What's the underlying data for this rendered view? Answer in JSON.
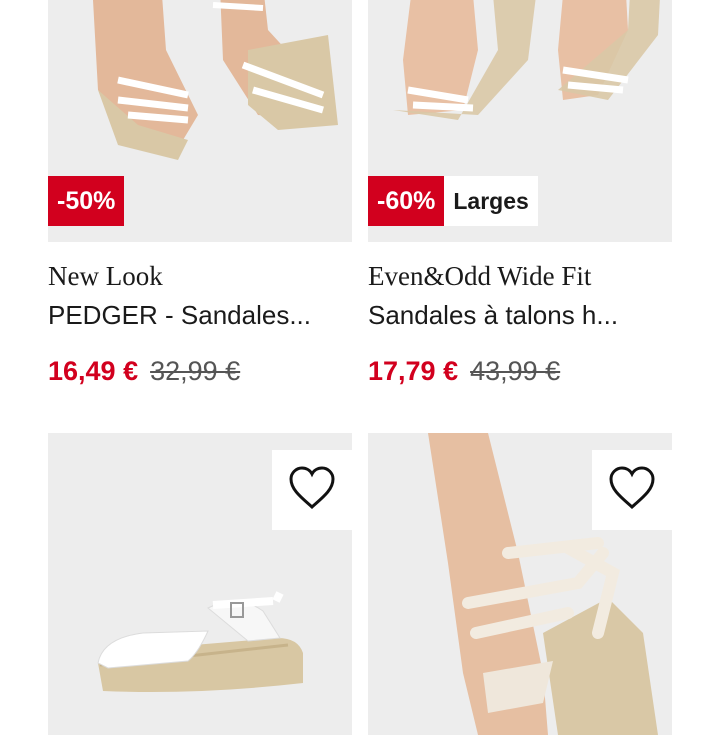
{
  "colors": {
    "sale_red": "#d2001e"
  },
  "products": [
    {
      "brand": "New Look",
      "name": "PEDGER - Sandales...",
      "price": "16,49 €",
      "original_price": "32,99 €",
      "badges": [
        {
          "text": "-50%",
          "kind": "discount"
        }
      ]
    },
    {
      "brand": "Even&Odd Wide Fit",
      "name": "Sandales à talons h...",
      "price": "17,79 €",
      "original_price": "43,99 €",
      "badges": [
        {
          "text": "-60%",
          "kind": "discount"
        },
        {
          "text": "Larges",
          "kind": "tag"
        }
      ]
    },
    {
      "wishlist_icon": "heart-outline-icon"
    },
    {
      "wishlist_icon": "heart-outline-icon"
    }
  ]
}
